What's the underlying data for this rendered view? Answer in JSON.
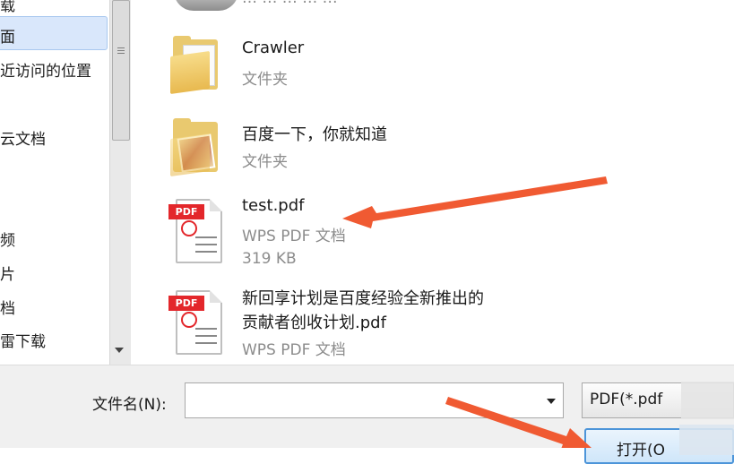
{
  "nav": {
    "items": [
      {
        "label": "载"
      },
      {
        "label": "面"
      },
      {
        "label": "近访问的位置"
      },
      {
        "label": "云文档"
      },
      {
        "label": "频"
      },
      {
        "label": "片"
      },
      {
        "label": "档"
      },
      {
        "label": "雷下载"
      }
    ]
  },
  "files": [
    {
      "name": "Crawler",
      "type": "文件夹",
      "icon": "folder-icon"
    },
    {
      "name": "百度一下，你就知道",
      "type": "文件夹",
      "icon": "folder-photo-icon"
    },
    {
      "name": "test.pdf",
      "type": "WPS PDF 文档",
      "size": "319 KB",
      "icon": "pdf-icon",
      "badge": "PDF"
    },
    {
      "name_line1": "新回享计划是百度经验全新推出的",
      "name_line2": "贡献者创收计划.pdf",
      "type": "WPS PDF 文档",
      "icon": "pdf-icon",
      "badge": "PDF"
    }
  ],
  "partial": {
    "text": "… … … … …"
  },
  "bottom": {
    "filename_label": "文件名(N):",
    "filename_value": "",
    "filter_label": "PDF(*.pdf",
    "open_label": "打开(O"
  },
  "colors": {
    "arrow": "#f05a32",
    "selection": "#d9e7fb",
    "pdf_badge": "#e3272b"
  }
}
